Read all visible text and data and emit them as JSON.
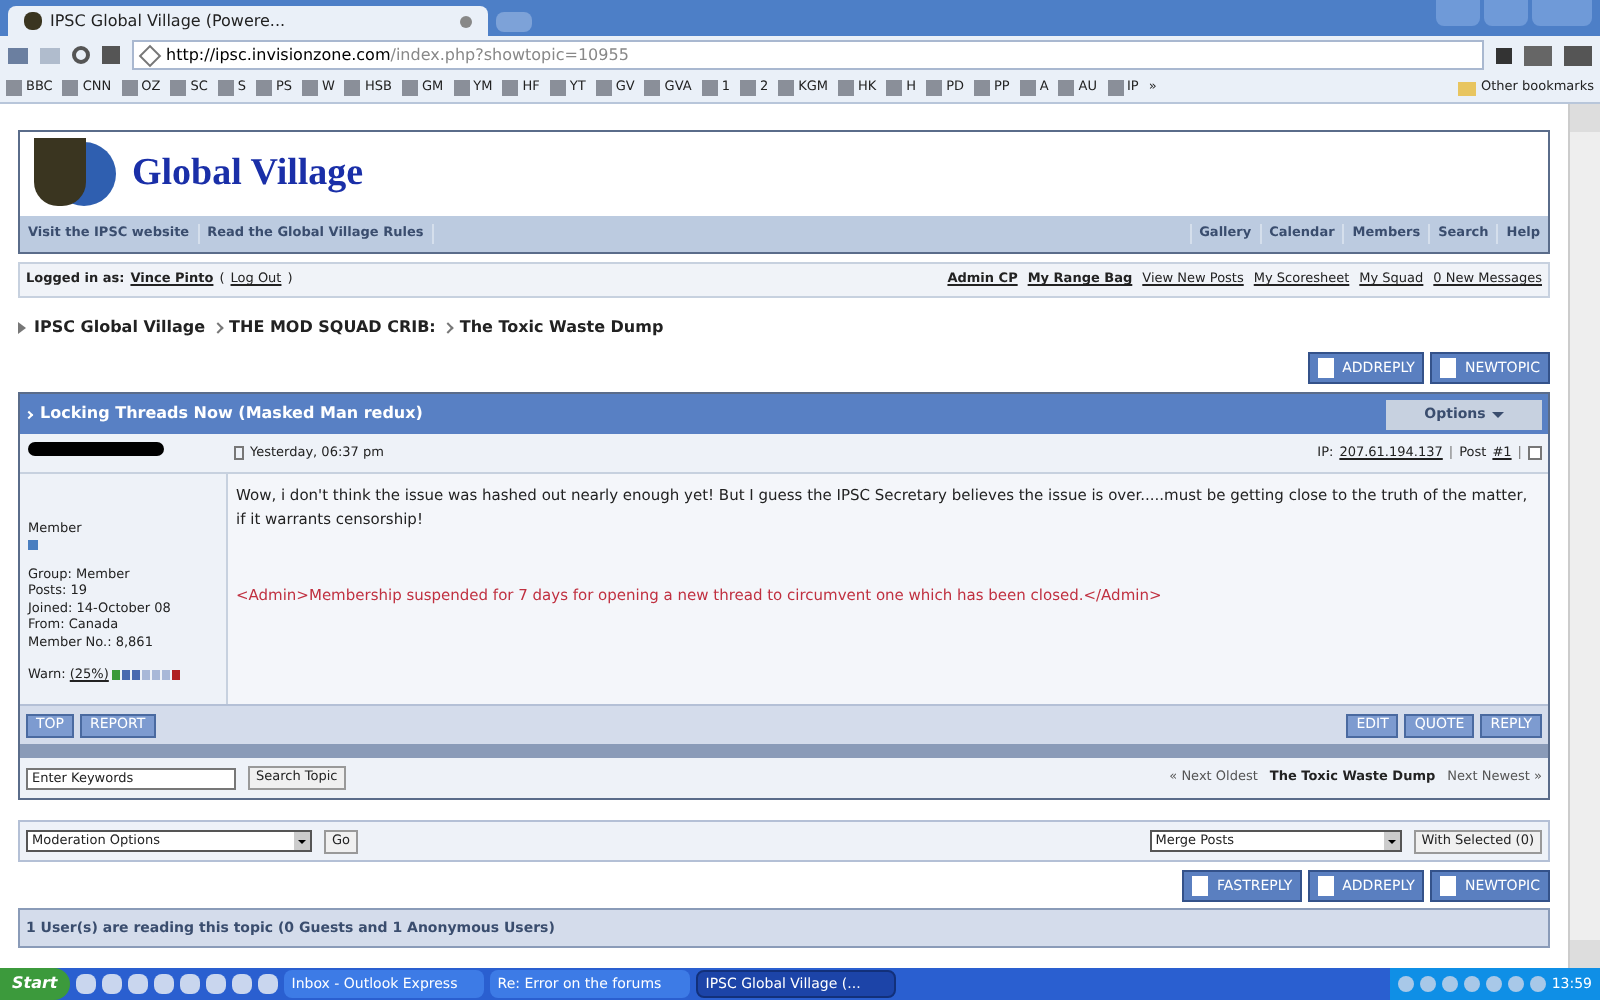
{
  "browser": {
    "tab_title": "IPSC Global Village (Powere...",
    "url_host": "http://ipsc.invisionzone.com",
    "url_path": "/index.php?showtopic=10955",
    "bookmarks": [
      "BBC",
      "CNN",
      "OZ",
      "SC",
      "S",
      "PS",
      "W",
      "HSB",
      "GM",
      "YM",
      "HF",
      "YT",
      "GV",
      "GVA",
      "1",
      "2",
      "KGM",
      "HK",
      "H",
      "PD",
      "PP",
      "A",
      "AU",
      "IP"
    ],
    "more": "»",
    "other_bookmarks": "Other bookmarks"
  },
  "site": {
    "title": "Global Village",
    "nav_left": [
      "Visit the IPSC website",
      "Read the Global Village Rules"
    ],
    "nav_right": [
      "Gallery",
      "Calendar",
      "Members",
      "Search",
      "Help"
    ]
  },
  "user_bar": {
    "label": "Logged in as:",
    "user": "Vince Pinto",
    "paren_open": "(",
    "logout": "Log Out",
    "paren_close": ")",
    "links": [
      "Admin CP",
      "My Range Bag",
      "View New Posts",
      "My Scoresheet",
      "My Squad",
      "0 New Messages"
    ]
  },
  "breadcrumb": [
    "IPSC Global Village",
    "THE MOD SQUAD CRIB:",
    "The Toxic Waste Dump"
  ],
  "top_buttons": [
    "ADDREPLY",
    "NEWTOPIC"
  ],
  "topic": {
    "title": "Locking Threads Now (Masked Man redux)",
    "options": "Options",
    "post": {
      "time": "Yesterday, 06:37 pm",
      "ip_label": "IP:",
      "ip": "207.61.194.137",
      "separator": "|",
      "post_label": "Post",
      "post_no": "#1",
      "checked": false,
      "rank": "Member",
      "details": [
        "Group: Member",
        "Posts: 19",
        "Joined: 14-October 08",
        "From: Canada",
        "Member No.: 8,861"
      ],
      "warn_label": "Warn:",
      "warn": "(25%)",
      "body": "Wow, i don't think the issue was hashed out nearly enough yet! But I guess the IPSC Secretary believes the issue is over.....must be getting close to the truth of the matter, if it warrants censorship!",
      "admin_note": "<Admin>Membership suspended for 7 days for opening a new thread to circumvent one which has been closed.</Admin>",
      "left_buttons": [
        "TOP",
        "REPORT"
      ],
      "right_buttons": [
        "EDIT",
        "QUOTE",
        "REPLY"
      ]
    }
  },
  "search": {
    "placeholder": "Enter Keywords",
    "button": "Search Topic",
    "prev": "« Next Oldest",
    "current": "The Toxic Waste Dump",
    "next": "Next Newest »"
  },
  "moderation": {
    "select": "Moderation Options",
    "go": "Go",
    "merge": "Merge Posts",
    "with_selected": "With Selected (0)"
  },
  "bottom_buttons": [
    "FASTREPLY",
    "ADDREPLY",
    "NEWTOPIC"
  ],
  "readers": "1 User(s) are reading this topic (0 Guests and 1 Anonymous Users)",
  "taskbar": {
    "start": "Start",
    "windows": [
      {
        "label": "Inbox - Outlook Express",
        "selected": false
      },
      {
        "label": "Re: Error on the forums",
        "selected": false
      },
      {
        "label": "IPSC Global Village (...",
        "selected": true
      }
    ],
    "clock": "13:59"
  }
}
